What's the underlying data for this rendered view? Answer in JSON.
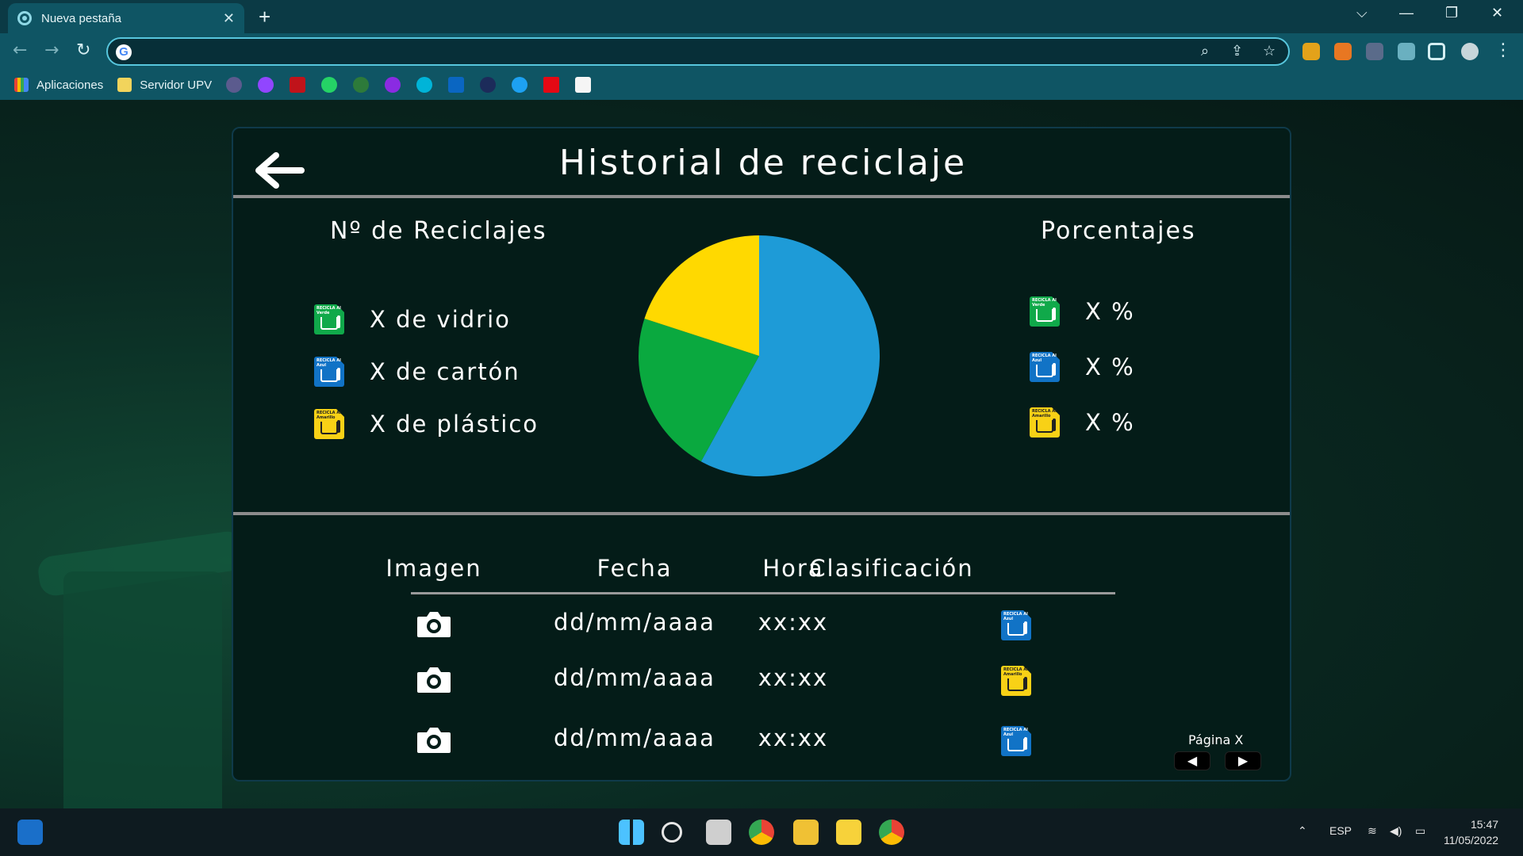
{
  "browser": {
    "tab_title": "Nueva pestaña",
    "tab_close": "✕",
    "new_tab": "+",
    "bookmarks": [
      {
        "label": "Aplicaciones"
      },
      {
        "label": "Servidor UPV"
      }
    ],
    "window_controls": {
      "chevron": "⌵",
      "minimize": "—",
      "restore": "❐",
      "close": "✕"
    }
  },
  "page": {
    "title": "Historial de reciclaje",
    "counts_title": "Nº de Reciclajes",
    "percent_title": "Porcentajes",
    "counts": [
      {
        "label": "X de vidrio",
        "color": "#10a94a",
        "badge": "RECICLA Al Verde"
      },
      {
        "label": "X de cartón",
        "color": "#1173c6",
        "badge": "RECICLA Al Azul"
      },
      {
        "label": "X de plástico",
        "color": "#f8d116",
        "badge": "RECICLA Al Amarillo"
      }
    ],
    "percentages": [
      {
        "label": "X %",
        "color": "#10a94a",
        "badge": "RECICLA Al Verde"
      },
      {
        "label": "X %",
        "color": "#1173c6",
        "badge": "RECICLA Al Azul"
      },
      {
        "label": "X %",
        "color": "#f8d116",
        "badge": "RECICLA Al Amarillo"
      }
    ],
    "table": {
      "headers": [
        "Imagen",
        "Fecha",
        "Hora",
        "Clasificación"
      ],
      "rows": [
        {
          "date": "dd/mm/aaaa",
          "time": "xx:xx",
          "class": "blue",
          "badge": "RECICLA Al Azul"
        },
        {
          "date": "dd/mm/aaaa",
          "time": "xx:xx",
          "class": "yellow",
          "badge": "RECICLA Al Amarillo"
        },
        {
          "date": "dd/mm/aaaa",
          "time": "xx:xx",
          "class": "blue",
          "badge": "RECICLA Al Azul"
        }
      ]
    },
    "pager": {
      "label": "Página X",
      "prev": "◀",
      "next": "▶"
    }
  },
  "chart_data": {
    "type": "pie",
    "values": [
      58,
      22,
      20
    ],
    "colors": [
      "#1e9bd7",
      "#0aa93f",
      "#ffd900"
    ]
  },
  "taskbar": {
    "language": "ESP",
    "time": "15:47",
    "date": "11/05/2022"
  }
}
